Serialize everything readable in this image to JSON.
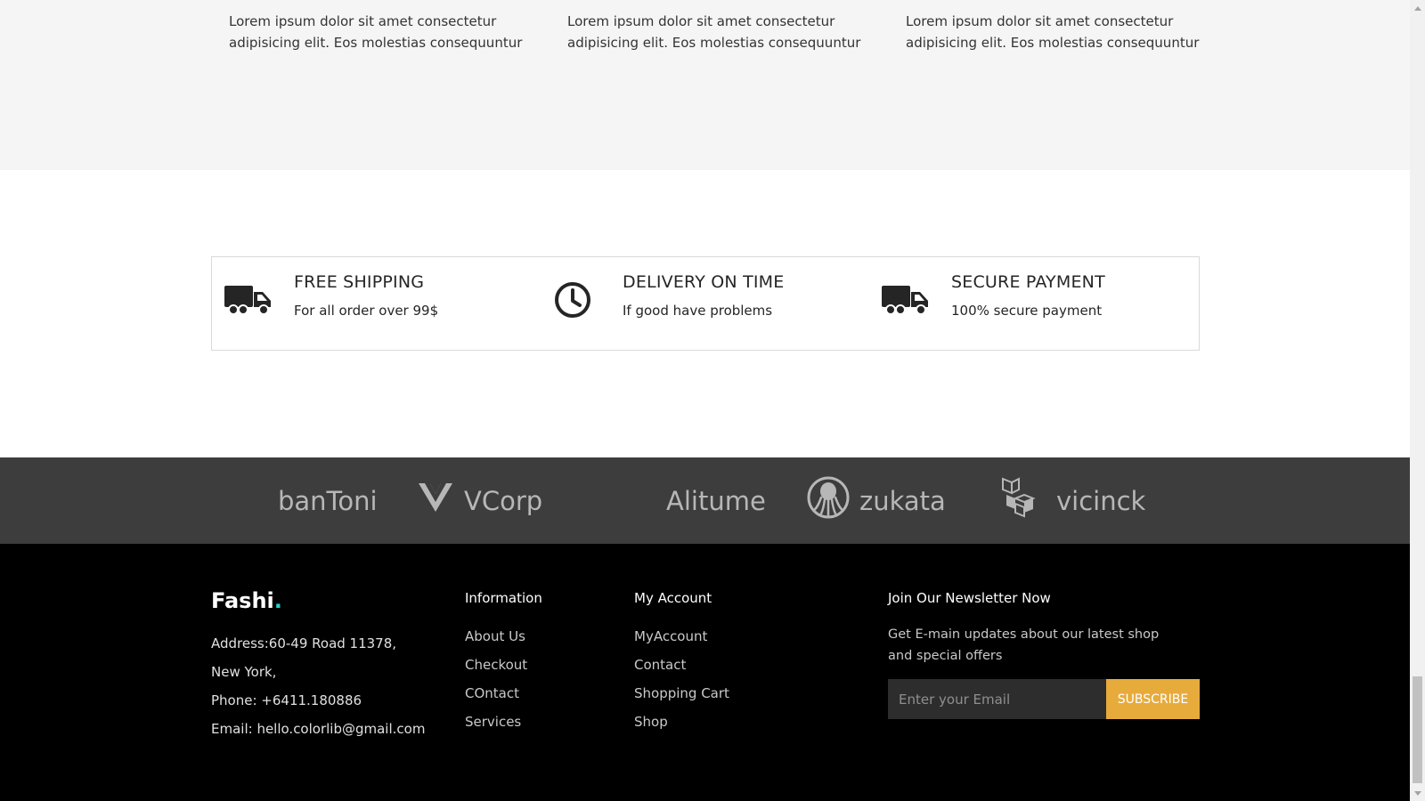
{
  "blog": {
    "excerpts": [
      "Lorem ipsum dolor sit amet consectetur adipisicing elit. Eos molestias consequuntur",
      "Lorem ipsum dolor sit amet consectetur adipisicing elit. Eos molestias consequuntur",
      "Lorem ipsum dolor sit amet consectetur adipisicing elit. Eos molestias consequuntur"
    ]
  },
  "benefits": [
    {
      "title": "FREE SHIPPING",
      "subtitle": "For all order over 99$",
      "icon": "truck-icon"
    },
    {
      "title": "DELIVERY ON TIME",
      "subtitle": "If good have problems",
      "icon": "clock-icon"
    },
    {
      "title": "SECURE PAYMENT",
      "subtitle": "100% secure payment",
      "icon": "truck-icon"
    }
  ],
  "partners": [
    {
      "name": "banToni",
      "icon": ""
    },
    {
      "name": "VCorp",
      "icon": "v-logo-icon"
    },
    {
      "name": "Alitume",
      "icon": ""
    },
    {
      "name": "zukata",
      "icon": "octopus-logo-icon"
    },
    {
      "name": "vicinck",
      "icon": "cubes-logo-icon"
    }
  ],
  "footer": {
    "brand": "Fashi",
    "brand_dot": ".",
    "contact": [
      "Address:60-49 Road 11378,",
      "New York,",
      "Phone: +6411.180886",
      "Email: hello.colorlib@gmail.com"
    ],
    "information": {
      "title": "Information",
      "links": [
        "About Us",
        "Checkout",
        "COntact",
        "Services"
      ]
    },
    "account": {
      "title": "My Account",
      "links": [
        "MyAccount",
        "Contact",
        "Shopping Cart",
        "Shop"
      ]
    },
    "newsletter": {
      "title": "Join Our Newsletter Now",
      "description": "Get E-main updates about our latest shop and special offers",
      "placeholder": "Enter your Email",
      "button": "SUBSCRIBE"
    }
  },
  "colors": {
    "accent": "#e7ab3c",
    "brand_dot": "#22d3c5",
    "footer_bg": "#000000",
    "partner_bg": "#3d3d3d"
  }
}
